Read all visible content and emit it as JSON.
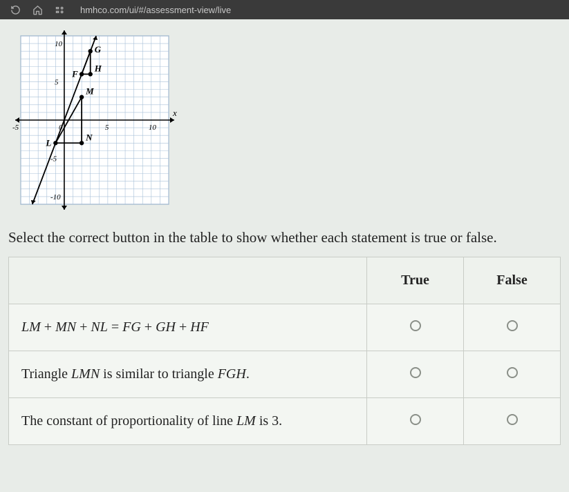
{
  "browser": {
    "url": "hmhco.com/ui/#/assessment-view/live"
  },
  "instruction": "Select the correct button in the table to show whether each statement is true or false.",
  "table": {
    "headers": {
      "true": "True",
      "false": "False"
    },
    "rows": [
      {
        "statement_html": "<span class='mi'>LM</span> + <span class='mi'>MN</span> + <span class='mi'>NL</span> = <span class='mi'>FG</span> + <span class='mi'>GH</span> + <span class='mi'>HF</span>"
      },
      {
        "statement_html": "Triangle <span class='mi'>LMN</span> is similar to triangle <span class='mi'>FGH</span>."
      },
      {
        "statement_html": "The constant of proportionality of line <span class='mi'>LM</span> is 3."
      }
    ]
  },
  "chart_data": {
    "type": "scatter",
    "title": "",
    "xlabel": "x",
    "ylabel": "",
    "xlim": [
      -5,
      12
    ],
    "ylim": [
      -11,
      11
    ],
    "grid": true,
    "x_ticks": [
      -5,
      0,
      5,
      10
    ],
    "y_ticks": [
      -10,
      -5,
      5,
      10
    ],
    "points": [
      {
        "name": "G",
        "x": 3,
        "y": 9
      },
      {
        "name": "F",
        "x": 2,
        "y": 6
      },
      {
        "name": "H",
        "x": 3,
        "y": 6
      },
      {
        "name": "M",
        "x": 2,
        "y": 3
      },
      {
        "name": "L",
        "x": -1,
        "y": -3
      },
      {
        "name": "N",
        "x": 2,
        "y": -3
      }
    ],
    "segments": [
      [
        "F",
        "G"
      ],
      [
        "G",
        "H"
      ],
      [
        "H",
        "F"
      ],
      [
        "L",
        "M"
      ],
      [
        "M",
        "N"
      ],
      [
        "N",
        "L"
      ]
    ],
    "extra_line": {
      "through": [
        "L",
        "G"
      ],
      "extends": true
    }
  }
}
